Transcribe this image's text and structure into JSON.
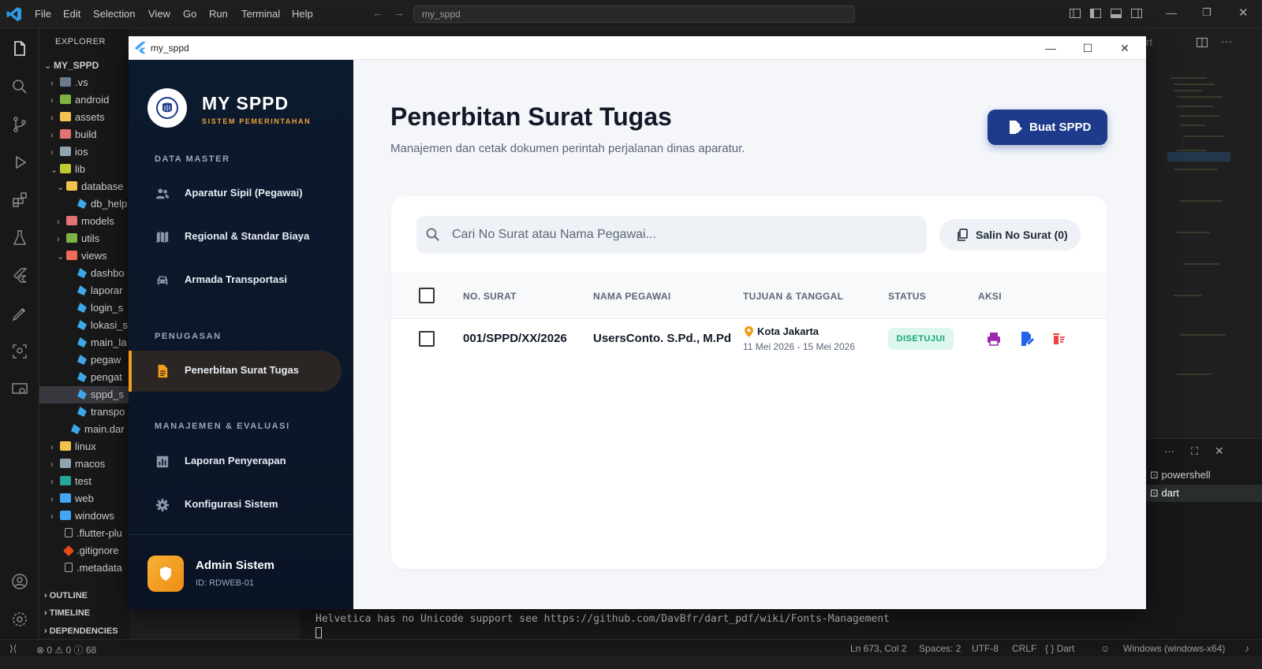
{
  "vscode": {
    "menu": [
      "File",
      "Edit",
      "Selection",
      "View",
      "Go",
      "Run",
      "Terminal",
      "Help"
    ],
    "command_center": "my_sppd",
    "explorer_title": "EXPLORER",
    "root": "MY_SPPD",
    "tree": [
      ".vs",
      "android",
      "assets",
      "build",
      "ios",
      "lib",
      "database",
      "db_help",
      "models",
      "utils",
      "views",
      "dashbo",
      "laporar",
      "login_s",
      "lokasi_s",
      "main_la",
      "pegaw",
      "pengat",
      "sppd_s",
      "transpo",
      "main.dar",
      "linux",
      "macos",
      "test",
      "web",
      "windows",
      ".flutter-plu",
      ".gitignore",
      ".metadata"
    ],
    "sections": [
      "OUTLINE",
      "TIMELINE",
      "DEPENDENCIES"
    ],
    "terminal_line": "Helvetica has no Unicode support see https://github.com/DavBfr/dart_pdf/wiki/Fonts-Management",
    "terminals": [
      "powershell",
      "dart"
    ],
    "editor_tab_fragment": "rt",
    "status": {
      "errors": "0",
      "warnings": "0",
      "info": "68",
      "position": "Ln 673, Col 2",
      "spaces": "Spaces: 2",
      "encoding": "UTF-8",
      "eol": "CRLF",
      "language": "Dart",
      "platform": "Windows (windows-x64)"
    }
  },
  "app": {
    "window_title": "my_sppd",
    "brand": "MY SPPD",
    "brand_sub": "SISTEM PEMERINTAHAN",
    "groups": {
      "master": "DATA MASTER",
      "assign": "PENUGASAN",
      "manage": "MANAJEMEN & EVALUASI"
    },
    "nav": [
      {
        "label": "Aparatur Sipil (Pegawai)",
        "icon": "users-icon"
      },
      {
        "label": "Regional & Standar Biaya",
        "icon": "map-icon"
      },
      {
        "label": "Armada Transportasi",
        "icon": "car-icon"
      },
      {
        "label": "Penerbitan Surat Tugas",
        "icon": "document-icon"
      },
      {
        "label": "Laporan Penyerapan",
        "icon": "chart-icon"
      },
      {
        "label": "Konfigurasi Sistem",
        "icon": "gear-icon"
      }
    ],
    "user": {
      "name": "Admin Sistem",
      "id": "ID: RDWEB-01"
    },
    "page_title": "Penerbitan Surat Tugas",
    "page_subtitle": "Manajemen dan cetak dokumen perintah perjalanan dinas aparatur.",
    "new_button": "Buat SPPD",
    "search_placeholder": "Cari No Surat atau Nama Pegawai...",
    "copy_button": "Salin No Surat (0)",
    "columns": [
      "NO. SURAT",
      "NAMA PEGAWAI",
      "TUJUAN & TANGGAL",
      "STATUS",
      "AKSI"
    ],
    "rows": [
      {
        "no": "001/SPPD/XX/2026",
        "name": "UsersConto. S.Pd., M.Pd",
        "city": "Kota Jakarta",
        "date": "11 Mei 2026 - 15 Mei 2026",
        "status": "DISETUJUI"
      }
    ],
    "colors": {
      "accent": "#1e3a8a",
      "sidebar": "#0c1a2e",
      "active": "#f29b1d",
      "approved": "#10a37f"
    }
  }
}
